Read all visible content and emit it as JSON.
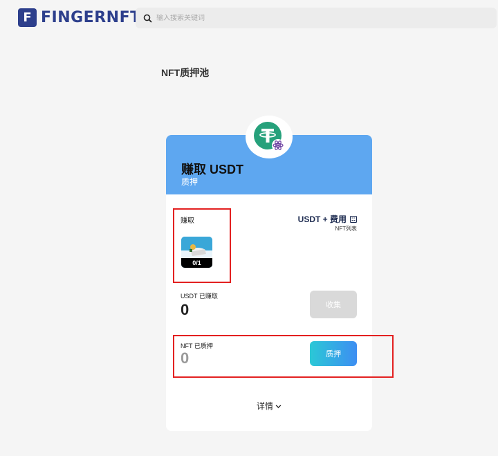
{
  "header": {
    "logo_letter": "F",
    "logo_text": "FINGERNFT",
    "search_placeholder": "输入搜索关键词"
  },
  "page": {
    "title": "NFT质押池"
  },
  "card": {
    "title": "赚取 USDT",
    "subtitle": "质押",
    "earn_label": "赚取",
    "nft_count": "0/1",
    "fee_title": "USDT + 费用",
    "fee_sub": "NFT列表",
    "usdt_label": "USDT 已赚取",
    "usdt_value": "0",
    "collect_label": "收集",
    "nft_staked_label": "NFT 已质押",
    "nft_staked_value": "0",
    "stake_label": "质押",
    "details_label": "详情"
  },
  "colors": {
    "brand": "#2d3f8c",
    "card_header": "#5ea7f0",
    "tether": "#26a17b",
    "annotation": "#e32020"
  }
}
